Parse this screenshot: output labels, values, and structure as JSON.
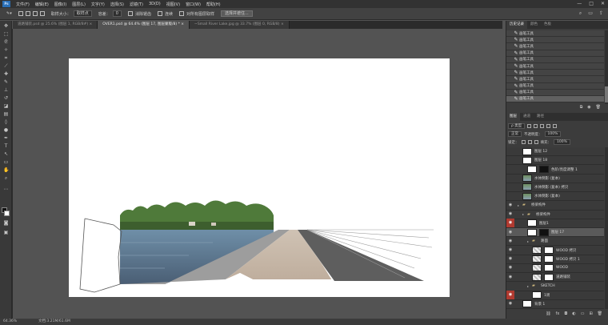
{
  "menubar": {
    "logo": "Ps",
    "items": [
      "文件(F)",
      "编辑(E)",
      "图像(I)",
      "图层(L)",
      "文字(Y)",
      "选择(S)",
      "滤镜(T)",
      "3D(D)",
      "视图(V)",
      "窗口(W)",
      "帮助(H)"
    ],
    "window_controls": [
      "—",
      "□",
      "✕"
    ]
  },
  "options": {
    "sample_label": "取样大小：",
    "sample_value": "取样点",
    "tolerance_label": "容差：",
    "tolerance_value": "0",
    "antialias_label": "消除锯齿",
    "contiguous_label": "连续",
    "all_layers_label": "对所有图层取样",
    "refine_button": "选择并遮住..."
  },
  "tabs": [
    {
      "label": "道路铺装.psd @ 25.6% (图层 1, RGB/8#) ×",
      "active": false
    },
    {
      "label": "OVER1.psd @ 64.4% (图层 17, 图层蒙版/8) * ×",
      "active": true
    },
    {
      "label": "~Small River Lake.jpg @ 33.7% (图层 0, RGB/8) ×",
      "active": false
    }
  ],
  "status": {
    "zoom": "64.36%",
    "doc_size": "文档:3.21M/61.6M"
  },
  "history": {
    "tabs": [
      "历史记录",
      "颜色",
      "色板"
    ],
    "rows": [
      "画笔工具",
      "画笔工具",
      "画笔工具",
      "画笔工具",
      "画笔工具",
      "画笔工具",
      "画笔工具",
      "画笔工具",
      "画笔工具",
      "画笔工具",
      "画笔工具"
    ],
    "active_index": 10
  },
  "layers": {
    "tabs": [
      "图层",
      "通道",
      "路径"
    ],
    "filter_label": "ρ 类型",
    "blend_mode": "正常",
    "opacity_label": "不透明度：",
    "opacity_value": "100%",
    "lock_label": "锁定：",
    "fill_label": "填充：",
    "fill_value": "100%",
    "rows": [
      {
        "name": "图层 12",
        "thumb": "white",
        "eye": false,
        "indent": 1
      },
      {
        "name": "图层 18",
        "thumb": "white",
        "eye": false,
        "indent": 1
      },
      {
        "name": "色阶/亮度调整 1",
        "thumb": "white",
        "mask": "black",
        "eye": false,
        "indent": 2
      },
      {
        "name": "水体倒影 (复本)",
        "thumb": "photo",
        "eye": false,
        "indent": 1
      },
      {
        "name": "水体倒影 (复本) 拷贝",
        "thumb": "photo",
        "eye": false,
        "indent": 1
      },
      {
        "name": "水体倒影 (复本)",
        "thumb": "photo",
        "eye": false,
        "indent": 1
      },
      {
        "name": "桥梁构件",
        "folder": true,
        "eye": true,
        "indent": 0
      },
      {
        "name": "桥梁构件",
        "folder": true,
        "eye": true,
        "indent": 1
      },
      {
        "name": "图层1",
        "thumb": "white",
        "eye": true,
        "red": true,
        "indent": 2
      },
      {
        "name": "图层 17",
        "thumb": "white",
        "mask": "black",
        "eye": true,
        "selected": true,
        "indent": 2
      },
      {
        "name": "路面",
        "folder": true,
        "eye": true,
        "indent": 2
      },
      {
        "name": "WOOD 拷贝",
        "thumb": "checker",
        "mask": "white",
        "eye": true,
        "indent": 3
      },
      {
        "name": "WOOD 拷贝 1",
        "thumb": "checker",
        "mask": "white",
        "eye": true,
        "indent": 3
      },
      {
        "name": "WOOD",
        "thumb": "checker",
        "mask": "white",
        "eye": true,
        "indent": 3
      },
      {
        "name": "道路铺装",
        "thumb": "checker",
        "mask": "white",
        "eye": true,
        "indent": 3
      },
      {
        "name": "SKETCH",
        "folder": true,
        "eye": false,
        "indent": 2
      },
      {
        "name": "1周",
        "thumb": "white",
        "eye": true,
        "red": true,
        "indent": 3
      },
      {
        "name": "背景 1",
        "thumb": "white",
        "eye": true,
        "indent": 1
      }
    ]
  },
  "colors": {
    "foreground": "#111111",
    "background": "#ffffff",
    "visibility_highlight": "#b03a30"
  }
}
